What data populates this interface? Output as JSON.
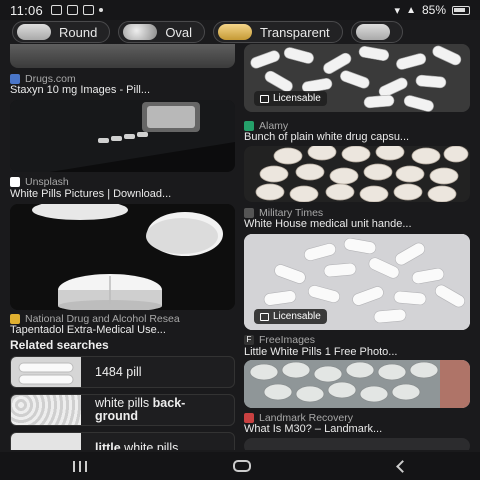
{
  "status": {
    "time": "11:06",
    "battery": "85%"
  },
  "chips": [
    {
      "label": "Round"
    },
    {
      "label": "Oval"
    },
    {
      "label": "Transparent"
    }
  ],
  "left": [
    {
      "source": "Drugs.com",
      "title": "Staxyn 10 mg Images - Pill..."
    },
    {
      "source": "Unsplash",
      "title": "White Pills Pictures | Download..."
    },
    {
      "source": "National Drug and Alcohol Resea",
      "title": "Tapentadol Extra-Medical Use..."
    }
  ],
  "related": {
    "heading": "Related searches",
    "items": [
      {
        "text": "1484 pill"
      },
      {
        "text_a": "white pills ",
        "text_b": "back-",
        "text_c": "ground"
      },
      {
        "text_a": "little",
        "text_b": " white pills"
      }
    ]
  },
  "right": [
    {
      "source": "Alamy",
      "title": "Bunch of plain white drug capsu...",
      "badge": "Licensable"
    },
    {
      "source": "Military Times",
      "title": "White House medical unit hande..."
    },
    {
      "source": "FreeImages",
      "title": "Little White Pills 1 Free Photo...",
      "badge": "Licensable"
    },
    {
      "source": "Landmark Recovery",
      "title": "What Is M30? – Landmark..."
    }
  ],
  "colors": {
    "background": "#1a1a1c",
    "chip_border": "#4a4a4c"
  }
}
